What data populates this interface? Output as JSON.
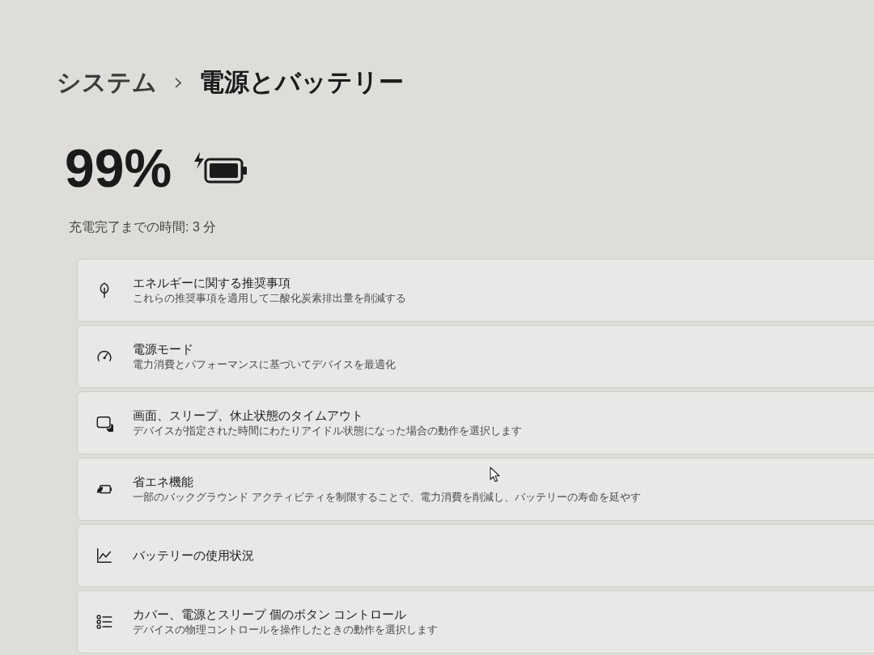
{
  "breadcrumb": {
    "parent": "システム",
    "current": "電源とバッテリー"
  },
  "battery": {
    "percentage": "99%",
    "charging": true,
    "time_to_full": "充電完了までの時間: 3 分"
  },
  "settings": [
    {
      "title": "エネルギーに関する推奨事項",
      "description": "これらの推奨事項を適用して二酸化炭素排出量を削減する"
    },
    {
      "title": "電源モード",
      "description": "電力消費とパフォーマンスに基づいてデバイスを最適化"
    },
    {
      "title": "画面、スリープ、休止状態のタイムアウト",
      "description": "デバイスが指定された時間にわたりアイドル状態になった場合の動作を選択します"
    },
    {
      "title": "省エネ機能",
      "description": "一部のバックグラウンド アクティビティを制限することで、電力消費を削減し、バッテリーの寿命を延やす"
    },
    {
      "title": "バッテリーの使用状況"
    },
    {
      "title": "カバー、電源とスリープ 個のボタン コントロール",
      "description": "デバイスの物理コントロールを操作したときの動作を選択します"
    }
  ]
}
